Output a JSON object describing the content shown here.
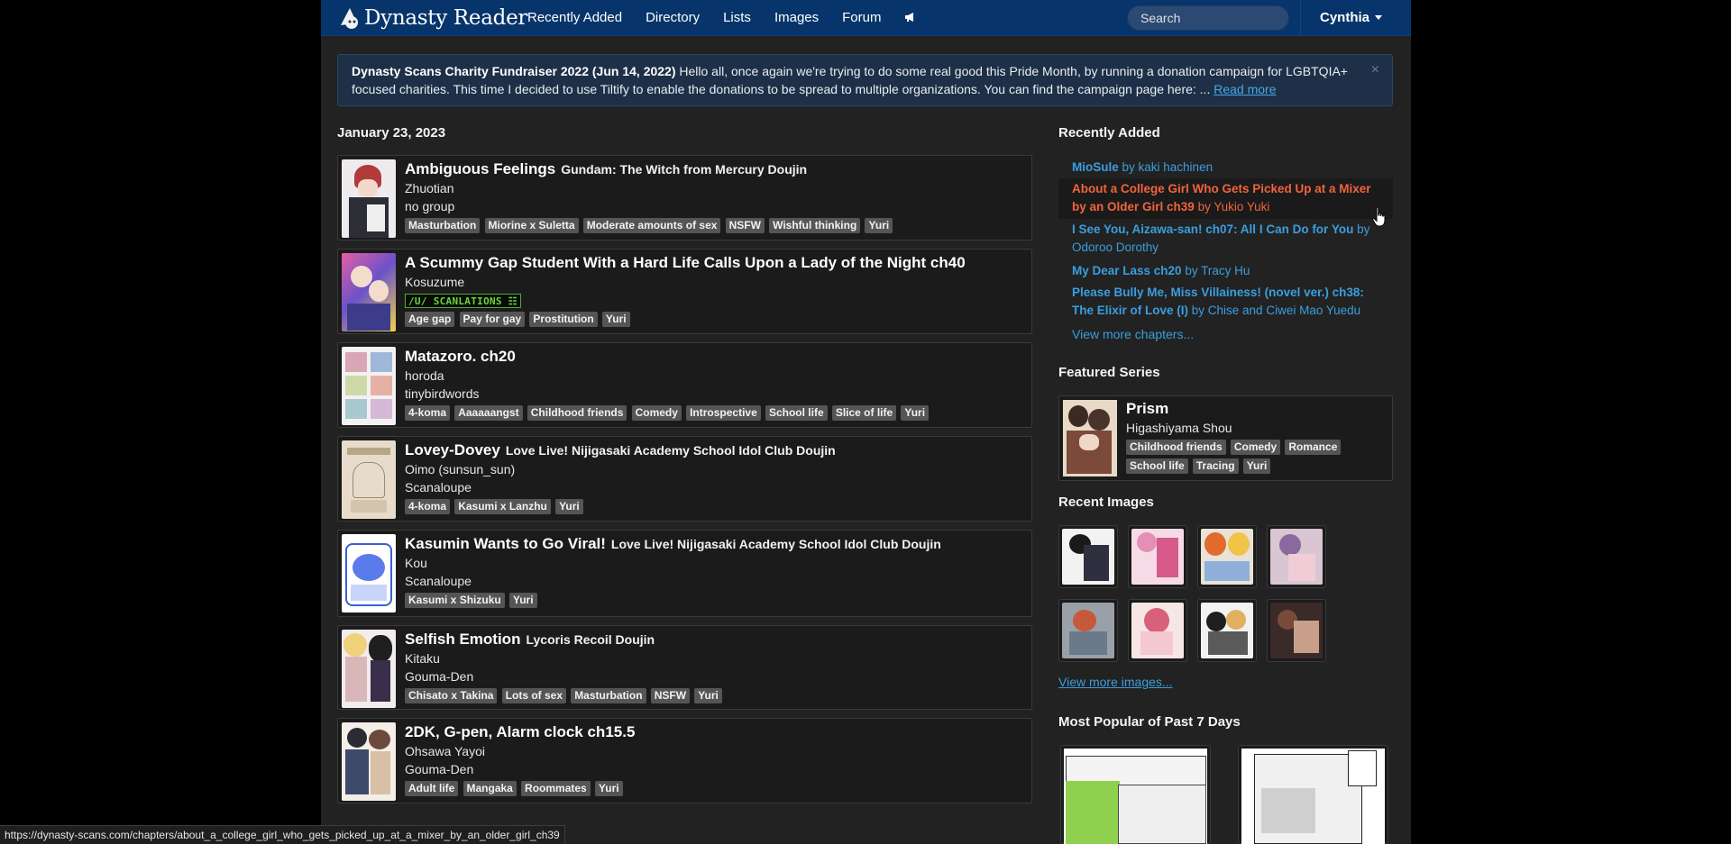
{
  "nav": {
    "brand": "Dynasty Reader",
    "items": [
      "Recently Added",
      "Directory",
      "Lists",
      "Images",
      "Forum"
    ],
    "megaphone_icon": "megaphone-icon",
    "search_placeholder": "Search",
    "user": "Cynthia"
  },
  "alert": {
    "title": "Dynasty Scans Charity Fundraiser 2022 (Jun 14, 2022)",
    "text": " Hello all, once again we're trying to do some real good this Pride Month, by running a donation campaign for LGBTQIA+ focused charities. This time I decided to use Tiltify to enable the donations to be spread to multiple organizations. You can find the campaign page here: ... ",
    "read_more": "Read more",
    "close": "×"
  },
  "main": {
    "date": "January 23, 2023",
    "entries": [
      {
        "title": "Ambiguous Feelings",
        "series": "Gundam: The Witch from Mercury Doujin",
        "author": "Zhuotian",
        "group": "no group",
        "group_logo": "",
        "tags": [
          "Masturbation",
          "Miorine x Suletta",
          "Moderate amounts of sex",
          "NSFW",
          "Wishful thinking",
          "Yuri"
        ]
      },
      {
        "title": "A Scummy Gap Student With a Hard Life Calls Upon a Lady of the Night ch40",
        "series": "",
        "author": "Kosuzume",
        "group": "",
        "group_logo": "/U/ SCANLATIONS ☷",
        "tags": [
          "Age gap",
          "Pay for gay",
          "Prostitution",
          "Yuri"
        ]
      },
      {
        "title": "Matazoro. ch20",
        "series": "",
        "author": "horoda",
        "group": "tinybirdwords",
        "group_logo": "",
        "tags": [
          "4-koma",
          "Aaaaaangst",
          "Childhood friends",
          "Comedy",
          "Introspective",
          "School life",
          "Slice of life",
          "Yuri"
        ]
      },
      {
        "title": "Lovey-Dovey",
        "series": "Love Live! Nijigasaki Academy School Idol Club Doujin",
        "author": "Oimo (sunsun_sun)",
        "group": "Scanaloupe",
        "group_logo": "",
        "tags": [
          "4-koma",
          "Kasumi x Lanzhu",
          "Yuri"
        ]
      },
      {
        "title": "Kasumin Wants to Go Viral!",
        "series": "Love Live! Nijigasaki Academy School Idol Club Doujin",
        "author": "Kou",
        "group": "Scanaloupe",
        "group_logo": "",
        "tags": [
          "Kasumi x Shizuku",
          "Yuri"
        ]
      },
      {
        "title": "Selfish Emotion",
        "series": "Lycoris Recoil Doujin",
        "author": "Kitaku",
        "group": "Gouma-Den",
        "group_logo": "",
        "tags": [
          "Chisato x Takina",
          "Lots of sex",
          "Masturbation",
          "NSFW",
          "Yuri"
        ]
      },
      {
        "title": "2DK, G-pen, Alarm clock ch15.5",
        "series": "",
        "author": "Ohsawa Yayoi",
        "group": "Gouma-Den",
        "group_logo": "",
        "tags": [
          "Adult life",
          "Mangaka",
          "Roommates",
          "Yuri"
        ]
      }
    ]
  },
  "sidebar": {
    "recently_added_heading": "Recently Added",
    "recent": [
      {
        "title": "MioSule",
        "by": " by kaki hachinen"
      },
      {
        "title": "About a College Girl Who Gets Picked Up at a Mixer by an Older Girl ch39",
        "by": " by Yukio Yuki"
      },
      {
        "title": "I See You, Aizawa-san! ch07: All I Can Do for You",
        "by": " by Odoroo Dorothy"
      },
      {
        "title": "My Dear Lass ch20",
        "by": " by Tracy Hu"
      },
      {
        "title": "Please Bully Me, Miss Villainess! (novel ver.) ch38: The Elixir of Love (I)",
        "by": " by Chise and Ciwei Mao Yuedu"
      }
    ],
    "view_more_chapters": "View more chapters...",
    "featured_heading": "Featured Series",
    "featured": {
      "title": "Prism",
      "author": "Higashiyama Shou",
      "tags": [
        "Childhood friends",
        "Comedy",
        "Romance",
        "School life",
        "Tracing",
        "Yuri"
      ]
    },
    "recent_images_heading": "Recent Images",
    "view_more_images": "View more images...",
    "popular_heading": "Most Popular of Past 7 Days"
  },
  "status_url": "https://dynasty-scans.com/chapters/about_a_college_girl_who_gets_picked_up_at_a_mixer_by_an_older_girl_ch39",
  "colors": {
    "navbar": "#07356b",
    "link": "#3a9ede",
    "hover_link": "#f0643a",
    "tag": "#555555",
    "panel": "#1b1b1b"
  }
}
